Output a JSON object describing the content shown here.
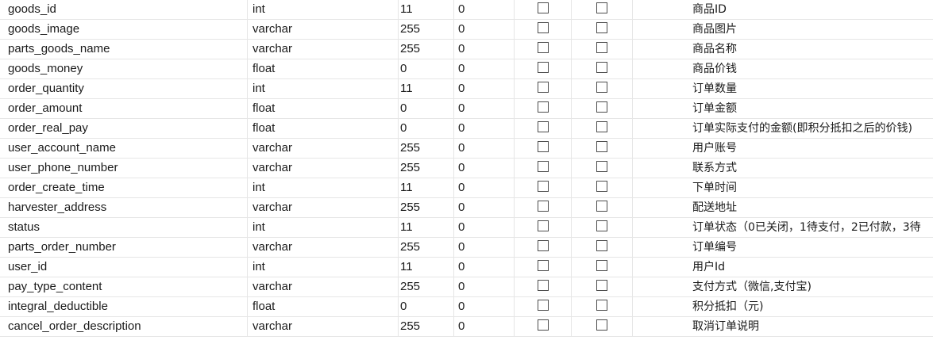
{
  "rows": [
    {
      "name": "goods_id",
      "type": "int",
      "length": "11",
      "decimals": "0",
      "not_null": false,
      "key": false,
      "comment": "商品ID"
    },
    {
      "name": "goods_image",
      "type": "varchar",
      "length": "255",
      "decimals": "0",
      "not_null": false,
      "key": false,
      "comment": "商品图片"
    },
    {
      "name": "parts_goods_name",
      "type": "varchar",
      "length": "255",
      "decimals": "0",
      "not_null": false,
      "key": false,
      "comment": "商品名称"
    },
    {
      "name": "goods_money",
      "type": "float",
      "length": "0",
      "decimals": "0",
      "not_null": false,
      "key": false,
      "comment": "商品价钱"
    },
    {
      "name": "order_quantity",
      "type": "int",
      "length": "11",
      "decimals": "0",
      "not_null": false,
      "key": false,
      "comment": "订单数量"
    },
    {
      "name": "order_amount",
      "type": "float",
      "length": "0",
      "decimals": "0",
      "not_null": false,
      "key": false,
      "comment": "订单金额"
    },
    {
      "name": "order_real_pay",
      "type": "float",
      "length": "0",
      "decimals": "0",
      "not_null": false,
      "key": false,
      "comment": "订单实际支付的金额(即积分抵扣之后的价钱)"
    },
    {
      "name": "user_account_name",
      "type": "varchar",
      "length": "255",
      "decimals": "0",
      "not_null": false,
      "key": false,
      "comment": "用户账号"
    },
    {
      "name": "user_phone_number",
      "type": "varchar",
      "length": "255",
      "decimals": "0",
      "not_null": false,
      "key": false,
      "comment": "联系方式"
    },
    {
      "name": "order_create_time",
      "type": "int",
      "length": "11",
      "decimals": "0",
      "not_null": false,
      "key": false,
      "comment": "下单时间"
    },
    {
      "name": "harvester_address",
      "type": "varchar",
      "length": "255",
      "decimals": "0",
      "not_null": false,
      "key": false,
      "comment": "配送地址"
    },
    {
      "name": "status",
      "type": "int",
      "length": "11",
      "decimals": "0",
      "not_null": false,
      "key": false,
      "comment": "订单状态（0已关闭，1待支付，2已付款，3待"
    },
    {
      "name": "parts_order_number",
      "type": "varchar",
      "length": "255",
      "decimals": "0",
      "not_null": false,
      "key": false,
      "comment": "订单编号"
    },
    {
      "name": "user_id",
      "type": "int",
      "length": "11",
      "decimals": "0",
      "not_null": false,
      "key": false,
      "comment": "用户Id"
    },
    {
      "name": "pay_type_content",
      "type": "varchar",
      "length": "255",
      "decimals": "0",
      "not_null": false,
      "key": false,
      "comment": "支付方式（微信,支付宝)"
    },
    {
      "name": "integral_deductible",
      "type": "float",
      "length": "0",
      "decimals": "0",
      "not_null": false,
      "key": false,
      "comment": "积分抵扣（元)"
    },
    {
      "name": "cancel_order_description",
      "type": "varchar",
      "length": "255",
      "decimals": "0",
      "not_null": false,
      "key": false,
      "comment": "取消订单说明"
    }
  ]
}
